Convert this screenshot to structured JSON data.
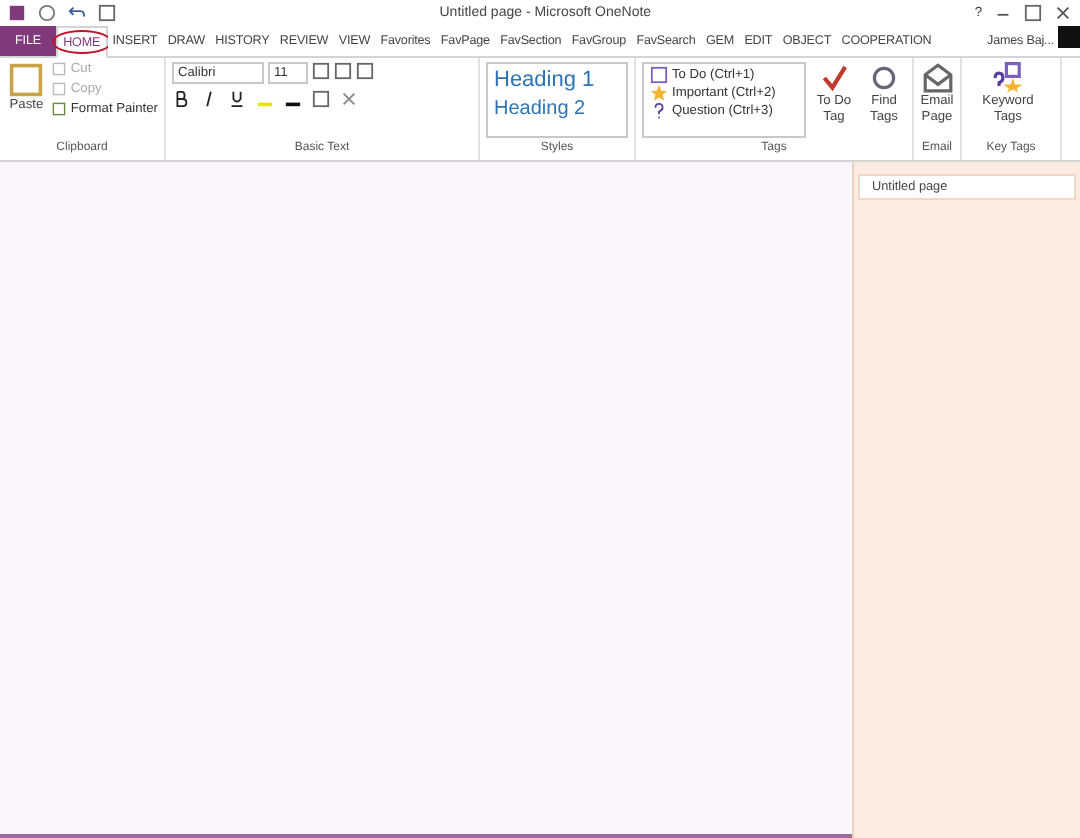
{
  "window": {
    "title": "Untitled page - Microsoft OneNote",
    "controls": [
      "?"
    ]
  },
  "tabs": [
    {
      "label": "FILE",
      "kind": "file",
      "selected": false
    },
    {
      "label": "HOME",
      "kind": "tab",
      "selected": true
    },
    {
      "label": "INSERT",
      "kind": "tab",
      "selected": false
    },
    {
      "label": "DRAW",
      "kind": "tab",
      "selected": false
    },
    {
      "label": "HISTORY",
      "kind": "tab",
      "selected": false
    },
    {
      "label": "REVIEW",
      "kind": "tab",
      "selected": false
    },
    {
      "label": "VIEW",
      "kind": "tab",
      "selected": false
    },
    {
      "label": "Favorites",
      "kind": "tab",
      "selected": false
    },
    {
      "label": "FavPage",
      "kind": "tab",
      "selected": false
    },
    {
      "label": "FavSection",
      "kind": "tab",
      "selected": false
    },
    {
      "label": "FavGroup",
      "kind": "tab",
      "selected": false
    },
    {
      "label": "FavSearch",
      "kind": "tab",
      "selected": false
    },
    {
      "label": "GEM",
      "kind": "tab",
      "selected": false
    },
    {
      "label": "EDIT",
      "kind": "tab",
      "selected": false
    },
    {
      "label": "OBJECT",
      "kind": "tab",
      "selected": false
    },
    {
      "label": "COOPERATION",
      "kind": "tab",
      "selected": false
    }
  ],
  "user": {
    "name": "James Baj..."
  },
  "ribbon": {
    "clipboard": {
      "label": "Clipboard",
      "paste": "Paste",
      "items": [
        {
          "label": "Cut",
          "disabled": true
        },
        {
          "label": "Copy",
          "disabled": true
        },
        {
          "label": "Format Painter",
          "disabled": false
        }
      ]
    },
    "basic_text": {
      "label": "Basic Text",
      "font": "Calibri",
      "size": "11"
    },
    "styles": {
      "label": "Styles",
      "items": [
        "Heading 1",
        "Heading 2"
      ]
    },
    "tags": {
      "label": "Tags",
      "items": [
        {
          "label": "To Do (Ctrl+1)",
          "kind": "todo"
        },
        {
          "label": "Important (Ctrl+2)",
          "kind": "star"
        },
        {
          "label": "Question (Ctrl+3)",
          "kind": "question"
        }
      ],
      "buttons": [
        {
          "label": "To Do Tag",
          "kind": "todo"
        },
        {
          "label": "Find Tags",
          "kind": "find"
        }
      ]
    },
    "email": {
      "label": "Email",
      "button": "Email Page"
    },
    "key_tags": {
      "label": "Key Tags",
      "button": "Keyword Tags"
    }
  },
  "pages": [
    {
      "title": "Untitled page",
      "selected": true
    }
  ]
}
